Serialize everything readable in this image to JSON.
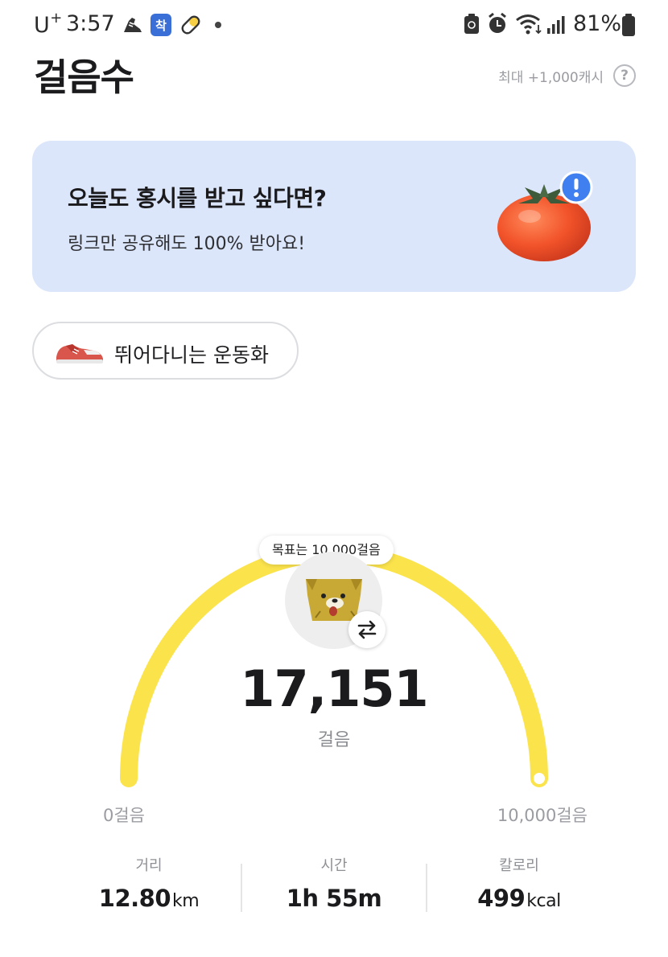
{
  "status_bar": {
    "carrier": "U",
    "carrier_sup": "+",
    "time": "3:57",
    "battery": "81%",
    "icons": [
      "shoe-notification-icon",
      "chak-app-icon",
      "pill-icon",
      "recycle-icon",
      "alarm-icon",
      "wifi-icon",
      "signal-icon",
      "battery-icon"
    ]
  },
  "header": {
    "title": "걸음수",
    "max_cash": "최대 +1,000캐시",
    "help": "?"
  },
  "banner": {
    "title": "오늘도 홍시를 받고 싶다면?",
    "subtitle": "링크만 공유해도 100% 받아요!",
    "icon": "persimmon-alert-icon"
  },
  "shoe_chip": {
    "label": "뛰어다니는 운동화",
    "icon": "sneaker-icon"
  },
  "gauge": {
    "goal_label": "목표는 10,000걸음",
    "steps": "17,151",
    "unit": "걸음",
    "min_label": "0걸음",
    "max_label": "10,000걸음",
    "progress": 1.0,
    "colors": {
      "track": "#fbe34c",
      "accent": "#fbe34c"
    }
  },
  "stats": {
    "distance": {
      "label": "거리",
      "value": "12.80",
      "unit": "km"
    },
    "time": {
      "label": "시간",
      "value": "1h 55m"
    },
    "calories": {
      "label": "칼로리",
      "value": "499",
      "unit": "kcal"
    }
  }
}
